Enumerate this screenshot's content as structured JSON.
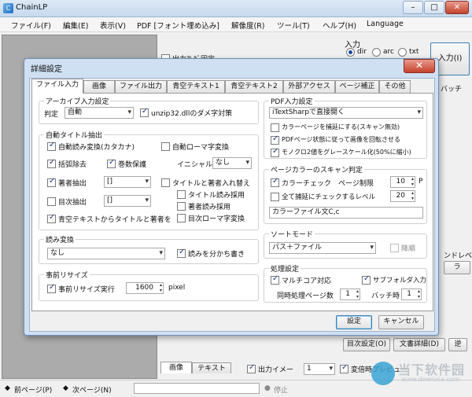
{
  "window": {
    "title": "ChainLP"
  },
  "menubar": [
    "ファイル(F)",
    "編集(E)",
    "表示(V)",
    "PDF [フォント埋め込み]",
    "解像度(R)",
    "ツール(T)",
    "ヘルプ(H)",
    "Language"
  ],
  "right_panel": {
    "input_label": "入力",
    "radio_dir": "dir",
    "radio_arc": "arc",
    "radio_txt": "txt",
    "input_button": "入力(I)",
    "batch_label": "バッチ",
    "tab_image": "画像",
    "tab_text": "テキスト",
    "output_image_label": "出力イメー",
    "output_select": "1",
    "variable_preview": "変倍時プレビュー",
    "level_label": "ンドレベル",
    "bira_label": "ラ",
    "partial_header_text": "出力ｱﾚｶﾞ固定",
    "toc_settings_button": "目次設定(O)",
    "doc_detail_button": "文書詳細(D)",
    "reverse_button": "逆"
  },
  "bottom_bar": {
    "prev_page": "前ページ(P)",
    "next_page": "次ページ(N)",
    "stop": "停止"
  },
  "dialog": {
    "title": "詳細設定",
    "close_icon": "x",
    "tabs": [
      "ファイル入力",
      "画像",
      "ファイル出力",
      "青空テキスト1",
      "青空テキスト2",
      "外部アクセス",
      "ページ補正",
      "その他"
    ],
    "archive": {
      "title": "アーカイブ入力設定",
      "judge_label": "判定",
      "judge_value": "自動",
      "unzip_label": "unzip32.dllのダメ字対策"
    },
    "auto_title": {
      "title": "自動タイトル抽出",
      "auto_katakana": "自動読み変換(カタカナ)",
      "auto_romaji": "自動ローマ字変換",
      "remove_brackets": "括弧除去",
      "keep_volume": "巻数保護",
      "initial_label": "イニシャル付",
      "initial_value": "なし",
      "author_extract": "著者抽出",
      "author_select": "[]",
      "swap_title_author": "タイトルと著者入れ替え",
      "use_title_reading": "タイトル読み採用",
      "toc_extract": "目次抽出",
      "toc_select": "[]",
      "use_author_reading": "著者読み採用",
      "toc_romaji": "目次ローマ字変換",
      "aozora_extract": "青空テキストからタイトルと著者を"
    },
    "reading": {
      "title": "読み変換",
      "value": "なし",
      "split_label": "読みを分かち書き"
    },
    "pre_resize": {
      "title": "事前リサイズ",
      "enable_label": "事前リサイズ実行",
      "size_value": "1600",
      "unit": "pixel"
    },
    "pdf_input": {
      "title": "PDF入力設定",
      "mode_value": "iTextSharpで直接開く",
      "color_page_label": "カラーページを捕延にする(スキャン無効)",
      "rotate_label": "PDFページ状態に従って画像を回転させる",
      "gray_label": "モノクロ2値をグレースケール化(50%に縮小)"
    },
    "page_color": {
      "title": "ページカラーのスキャン判定",
      "color_check": "カラーチェック",
      "page_limit_label": "ページ制限",
      "page_limit_value": "10",
      "page_limit_unit": "P",
      "check_all_label": "全て捕延にチェックするレベル",
      "level_value": "20",
      "color_file": "カラーファイル文C,c"
    },
    "sort_mode": {
      "title": "ソートモード",
      "value": "パス＋ファイル",
      "desc_label": "降順"
    },
    "processing": {
      "title": "処理設定",
      "multicore": "マルチコア対応",
      "subfolder": "サブフォルダ入力",
      "concurrent_label": "同時処理ページ数",
      "concurrent_value": "1",
      "batch_label": "バッチ時",
      "batch_value": "1"
    },
    "ok_button": "設定",
    "cancel_button": "キャンセル"
  },
  "watermark": {
    "title": "当下软件园",
    "subtitle": "www.downxia.com"
  },
  "colors": {
    "title_bar": "#c6d9ee",
    "dialog_frame": "#cfe0f3",
    "close_button": "#c4432c"
  }
}
